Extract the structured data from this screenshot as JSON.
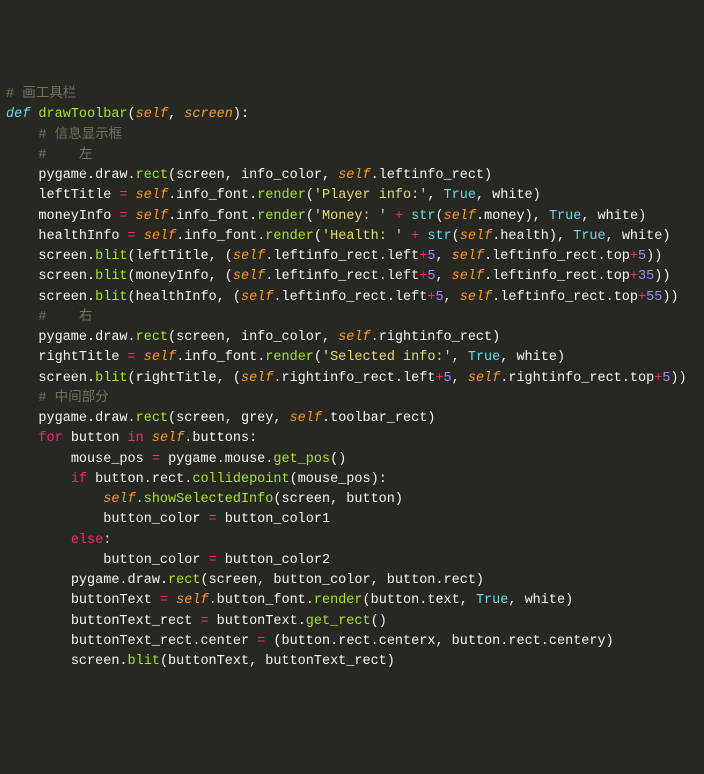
{
  "lines": {
    "c_toolbar": "# 画工具栏",
    "c_infobox": "# 信息显示框",
    "c_left": "#    左",
    "c_right": "#    右",
    "c_middle": "# 中间部分",
    "def_kw": "def",
    "drawToolbar": "drawToolbar",
    "self": "self",
    "screen": "screen",
    "pygame": "pygame",
    "draw": "draw",
    "rect": "rect",
    "info_color": "info_color",
    "leftinfo_rect": "leftinfo_rect",
    "rightinfo_rect": "rightinfo_rect",
    "leftTitle": "leftTitle",
    "rightTitle": "rightTitle",
    "info_font": "info_font",
    "render": "render",
    "player_info": "'Player info:'",
    "selected_info": "'Selected info:'",
    "True": "True",
    "white": "white",
    "moneyInfo": "moneyInfo",
    "money_str": "'Money: '",
    "str": "str",
    "money": "money",
    "healthInfo": "healthInfo",
    "health_str": "'Health: '",
    "health": "health",
    "blit": "blit",
    "left": "left",
    "top": "top",
    "n5": "5",
    "n35": "35",
    "n55": "55",
    "grey": "grey",
    "toolbar_rect": "toolbar_rect",
    "for": "for",
    "in": "in",
    "button": "button",
    "buttons": "buttons",
    "mouse_pos": "mouse_pos",
    "mouse": "mouse",
    "get_pos": "get_pos",
    "if": "if",
    "collidepoint": "collidepoint",
    "showSelectedInfo": "showSelectedInfo",
    "button_color": "button_color",
    "button_color1": "button_color1",
    "button_color2": "button_color2",
    "else": "else",
    "button_font": "button_font",
    "text": "text",
    "buttonText": "buttonText",
    "buttonText_rect": "buttonText_rect",
    "get_rect": "get_rect",
    "center": "center",
    "centerx": "centerx",
    "centery": "centery"
  }
}
